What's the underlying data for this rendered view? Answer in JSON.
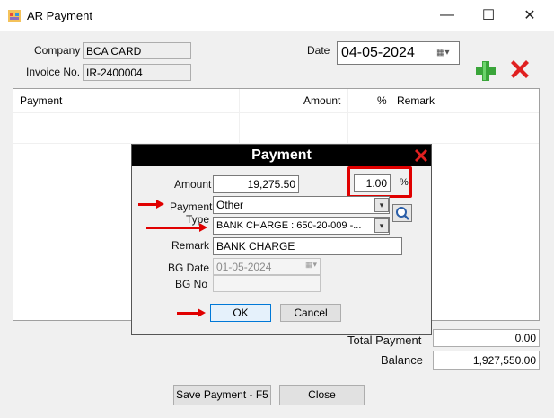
{
  "window": {
    "title": "AR Payment",
    "minimize_glyph": "—",
    "maximize_glyph": "☐",
    "close_glyph": "✕"
  },
  "form": {
    "company_label": "Company",
    "company_value": "BCA CARD",
    "invoice_label": "Invoice No.",
    "invoice_value": "IR-2400004",
    "date_label": "Date",
    "date_value": "04-05-2024",
    "add_icon": "plus-icon",
    "delete_icon": "x-icon"
  },
  "grid": {
    "columns": [
      "Payment",
      "Amount",
      "%",
      "Remark"
    ]
  },
  "totals": {
    "total_payment_label": "Total Payment",
    "total_payment_value": "0.00",
    "balance_label": "Balance",
    "balance_value": "1,927,550.00"
  },
  "buttons": {
    "save_label": "Save Payment - F5",
    "close_label": "Close"
  },
  "dialog": {
    "title": "Payment",
    "amount_label": "Amount",
    "amount_value": "19,275.50",
    "percent_value": "1.00",
    "percent_sign": "%",
    "payment_type_label_1": "Payment",
    "payment_type_label_2": "Type",
    "payment_type_value": "Other",
    "account_value": "BANK CHARGE : 650-20-009 -...",
    "remark_label": "Remark",
    "remark_value": "BANK CHARGE",
    "bg_date_label": "BG Date",
    "bg_date_value": "01-05-2024",
    "bg_no_label": "BG No",
    "bg_no_value": "",
    "ok_label": "OK",
    "cancel_label": "Cancel"
  },
  "colors": {
    "highlight": "#e00000",
    "dialog_title_bg": "#000000",
    "green_plus": "#3aa53a"
  }
}
